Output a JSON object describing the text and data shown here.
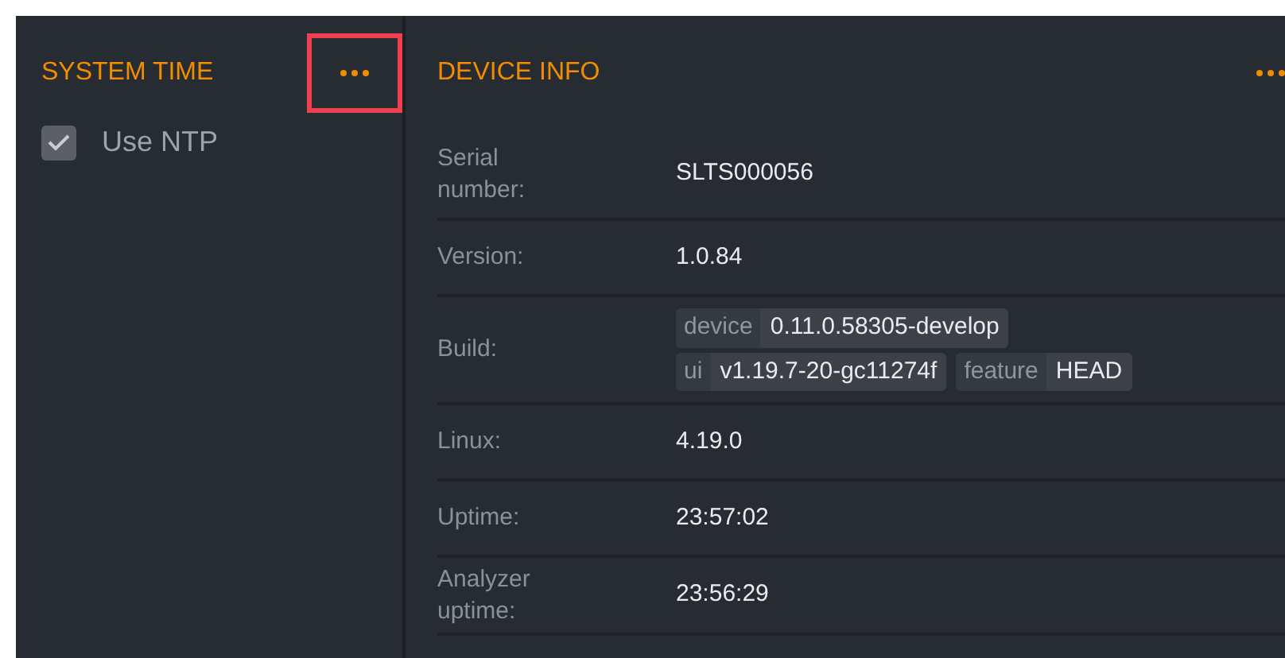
{
  "system_time": {
    "title": "SYSTEM TIME",
    "menu_highlighted": true,
    "use_ntp": {
      "label": "Use NTP",
      "checked": true,
      "disabled": true
    }
  },
  "device_info": {
    "title": "DEVICE INFO",
    "rows": [
      {
        "label": "Serial number:",
        "kind": "text",
        "value": "SLTS000056"
      },
      {
        "label": "Version:",
        "kind": "text",
        "value": "1.0.84"
      },
      {
        "label": "Build:",
        "kind": "tags",
        "lines": [
          [
            {
              "key": "device",
              "value": "0.11.0.58305-develop"
            }
          ],
          [
            {
              "key": "ui",
              "value": "v1.19.7-20-gc11274f"
            },
            {
              "key": "feature",
              "value": "HEAD"
            }
          ]
        ]
      },
      {
        "label": "Linux:",
        "kind": "text",
        "value": "4.19.0"
      },
      {
        "label": "Uptime:",
        "kind": "text",
        "value": "23:57:02"
      },
      {
        "label": "Analyzer uptime:",
        "kind": "text",
        "value": "23:56:29"
      }
    ]
  }
}
